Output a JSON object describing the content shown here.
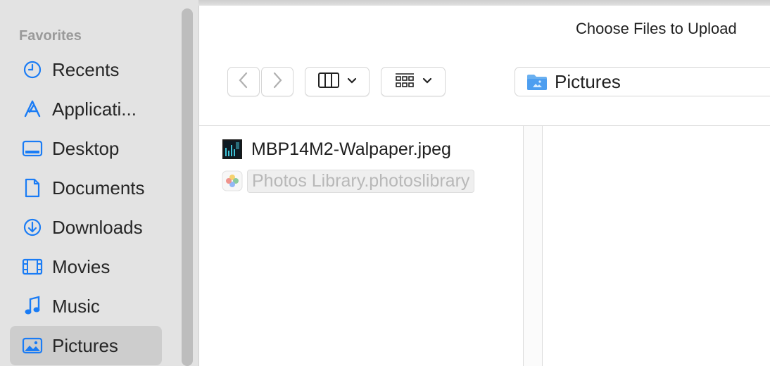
{
  "dialog": {
    "title": "Choose Files to Upload"
  },
  "sidebar": {
    "section_header": "Favorites",
    "items": [
      {
        "label": "Recents",
        "icon": "clock-icon"
      },
      {
        "label": "Applicati...",
        "icon": "applications-icon"
      },
      {
        "label": "Desktop",
        "icon": "desktop-icon"
      },
      {
        "label": "Documents",
        "icon": "document-icon"
      },
      {
        "label": "Downloads",
        "icon": "download-icon"
      },
      {
        "label": "Movies",
        "icon": "film-icon"
      },
      {
        "label": "Music",
        "icon": "music-note-icon"
      },
      {
        "label": "Pictures",
        "icon": "pictures-icon",
        "selected": true
      }
    ]
  },
  "toolbar": {
    "back_icon": "chevron-left-icon",
    "forward_icon": "chevron-right-icon",
    "view_icon": "column-view-icon",
    "group_icon": "grid-group-icon",
    "current_folder": "Pictures"
  },
  "files": [
    {
      "name": "MBP14M2-Walpaper.jpeg",
      "icon": "image-thumbnail-icon",
      "enabled": true
    },
    {
      "name": "Photos Library.photoslibrary",
      "icon": "photos-library-icon",
      "enabled": false
    }
  ],
  "colors": {
    "accent": "#1a7cf5",
    "sidebar_bg": "#e3e3e3",
    "selected_bg": "#cdcdcd"
  }
}
